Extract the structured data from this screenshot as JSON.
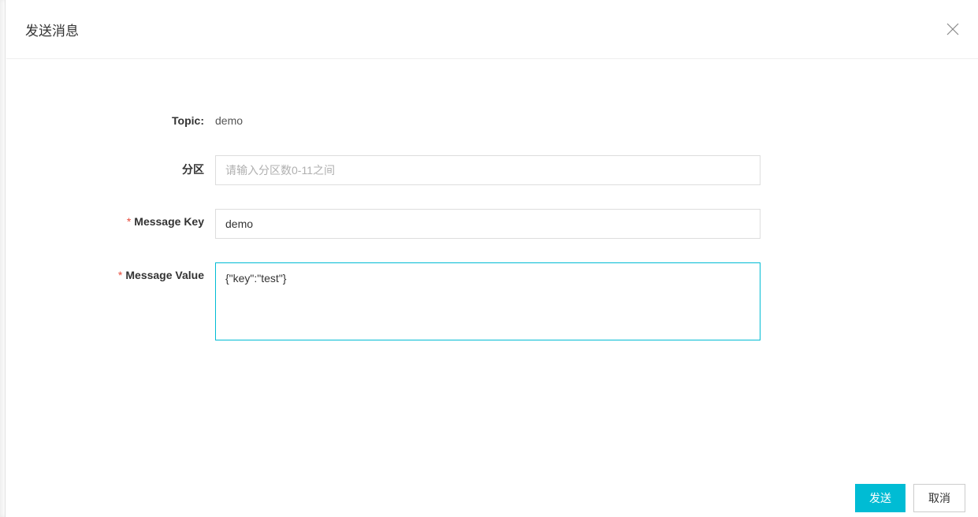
{
  "modal": {
    "title": "发送消息"
  },
  "form": {
    "topic_label": "Topic:",
    "topic_value": "demo",
    "partition_label": "分区",
    "partition_placeholder": "请输入分区数0-11之间",
    "partition_value": "",
    "message_key_label": "Message Key",
    "message_key_value": "demo",
    "message_value_label": "Message Value",
    "message_value_value": "{\"key\":\"test\"}"
  },
  "footer": {
    "submit_label": "发送",
    "cancel_label": "取消"
  }
}
